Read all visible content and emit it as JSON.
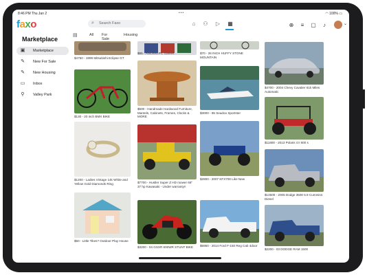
{
  "status": {
    "time_date": "8:46 PM   Thu Jan 2",
    "dots": "•••",
    "battery": "100%"
  },
  "logo": {
    "f": "f",
    "a": "a",
    "x": "x",
    "o": "o"
  },
  "search": {
    "placeholder": "Search Faxo"
  },
  "tabs": [
    "All",
    "For Sale",
    "Housing"
  ],
  "sidebar": {
    "title": "Marketplace",
    "items": [
      {
        "label": "Marketplace",
        "icon": "storefront-icon"
      },
      {
        "label": "New For Sale",
        "icon": "pencil-icon"
      },
      {
        "label": "New Housing",
        "icon": "pencil-icon"
      },
      {
        "label": "Inbox",
        "icon": "inbox-icon"
      },
      {
        "label": "Valley Park",
        "icon": "location-pin-icon"
      }
    ]
  },
  "listings": [
    {
      "caption": "$4750 - 1999 Mitsubishi Eclipse GT"
    },
    {
      "caption": "$65 - Assorted PC Games"
    },
    {
      "caption": "$70 - 26 INCH HUFFY STONE MOUNTAIN"
    },
    {
      "caption": "$4700 - 2004 Chevy Cavalier 61k Miles Automatic"
    },
    {
      "caption": "$130 - 20 inch BMX BIKE"
    },
    {
      "caption": "$500 - Handmade Hardwood Furniture, Mantels, Cabinets, Frames, Clocks & MORE"
    },
    {
      "caption": "$3000 - 95 Seadoo Sportster"
    },
    {
      "caption": "$11800 - 2013 Polaris rzr 800 s"
    },
    {
      "caption": "$1200 - Ladies Vintage 14k White and Yellow Gold Diamonds Ring"
    },
    {
      "caption": "$7700 - Hustler Super Z HD mower 66\" 37 hp Kawasaki - Under warranty!!"
    },
    {
      "caption": "$2800 - 2007 KFX700 Like New"
    },
    {
      "caption": "$14500 - 2005 Dodge 3500 5.9 Cummins Diesel"
    },
    {
      "caption": "$50 - Little Tikes? Outdoor Play House"
    },
    {
      "caption": "$3200 - 04 GSXR 600WR STUNT BIKE"
    },
    {
      "caption": "$6950 - 2014 Ford F-150 Reg Cab 4door"
    },
    {
      "caption": "$2200 - 03 DODGE RAM 1500"
    }
  ]
}
